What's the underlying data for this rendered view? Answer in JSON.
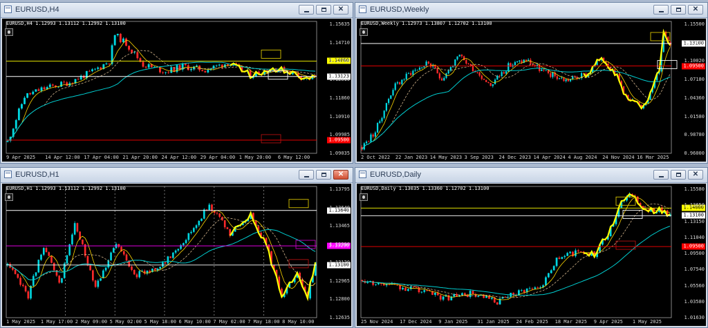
{
  "windows": [
    {
      "id": "h4",
      "title": "EURUSD,H4",
      "symbol_line": "EURUSD,H4  1.12993 1.13112 1.12992 1.13100",
      "prices": [
        "1.15635",
        "1.14710",
        "1.13760",
        "1.12810",
        "1.11860",
        "1.10910",
        "1.09985",
        "1.09035"
      ],
      "times": [
        "9 Apr 2025",
        "14 Apr 12:00",
        "17 Apr 04:00",
        "21 Apr 20:00",
        "24 Apr 12:00",
        "29 Apr 04:00",
        "1 May 20:00",
        "6 May 12:00"
      ],
      "tags": [
        {
          "text": "1.14000",
          "color": "#ffff00",
          "fg": "#000000"
        },
        {
          "text": "1.13123",
          "color": "#ffffff",
          "fg": "#000000"
        },
        {
          "text": "1.09500",
          "color": "#ff0000",
          "fg": "#ffffff"
        }
      ],
      "chart_data": {
        "type": "candlestick",
        "pmin": 1.0875,
        "pmax": 1.161,
        "n": 110,
        "seed": 11,
        "path": [
          [
            0,
            1.094
          ],
          [
            6,
            1.12
          ],
          [
            12,
            1.124
          ],
          [
            22,
            1.128
          ],
          [
            30,
            1.134
          ],
          [
            36,
            1.14
          ],
          [
            38,
            1.155
          ],
          [
            42,
            1.15
          ],
          [
            48,
            1.138
          ],
          [
            56,
            1.134
          ],
          [
            62,
            1.137
          ],
          [
            70,
            1.135
          ],
          [
            78,
            1.139
          ],
          [
            86,
            1.132
          ],
          [
            94,
            1.136
          ],
          [
            100,
            1.134
          ],
          [
            106,
            1.13
          ],
          [
            109,
            1.131
          ]
        ],
        "levels": [
          {
            "price": 1.14,
            "color": "#ffff00"
          },
          {
            "price": 1.13123,
            "color": "#ffffff"
          },
          {
            "price": 1.095,
            "color": "#ff0000"
          }
        ],
        "vgrid": [],
        "ma": [
          "#ffd700",
          "#d2b48c",
          "#00ced1"
        ]
      }
    },
    {
      "id": "weekly",
      "title": "EURUSD,Weekly",
      "symbol_line": "EURUSD,Weekly  1.12973 1.13807 1.12702 1.13100",
      "prices": [
        "1.15500",
        "1.12800",
        "1.10020",
        "1.07180",
        "1.04360",
        "1.01580",
        "0.98780",
        "0.96000"
      ],
      "times": [
        "2 Oct 2022",
        "22 Jan 2023",
        "14 May 2023",
        "3 Sep 2023",
        "24 Dec 2023",
        "14 Apr 2024",
        "4 Aug 2024",
        "24 Nov 2024",
        "16 Mar 2025"
      ],
      "tags": [
        {
          "text": "1.13100",
          "color": "#ffffff",
          "fg": "#000000"
        },
        {
          "text": "1.09500",
          "color": "#ff0000",
          "fg": "#ffffff"
        }
      ],
      "chart_data": {
        "type": "candlestick",
        "pmin": 0.955,
        "pmax": 1.162,
        "n": 140,
        "seed": 23,
        "path": [
          [
            0,
            0.965
          ],
          [
            6,
            0.99
          ],
          [
            14,
            1.06
          ],
          [
            22,
            1.085
          ],
          [
            30,
            1.1
          ],
          [
            36,
            1.075
          ],
          [
            44,
            1.11
          ],
          [
            52,
            1.085
          ],
          [
            58,
            1.065
          ],
          [
            66,
            1.095
          ],
          [
            74,
            1.105
          ],
          [
            82,
            1.085
          ],
          [
            92,
            1.072
          ],
          [
            102,
            1.082
          ],
          [
            108,
            1.11
          ],
          [
            114,
            1.085
          ],
          [
            120,
            1.04
          ],
          [
            126,
            1.03
          ],
          [
            130,
            1.05
          ],
          [
            134,
            1.09
          ],
          [
            136,
            1.15
          ],
          [
            139,
            1.131
          ]
        ],
        "levels": [
          {
            "price": 1.131,
            "color": "#ffffff"
          },
          {
            "price": 1.095,
            "color": "#ff0000"
          }
        ],
        "vgrid": [],
        "ma": [
          "#ffd700",
          "#d2b48c",
          "#00ced1"
        ]
      }
    },
    {
      "id": "h1",
      "title": "EURUSD,H1",
      "symbol_line": "EURUSD,H1  1.12993 1.13112 1.12992 1.13100",
      "prices": [
        "1.13795",
        "1.13640",
        "1.13465",
        "1.13290",
        "1.13120",
        "1.12965",
        "1.12800",
        "1.12635"
      ],
      "times": [
        "1 May 2025",
        "1 May 17:00",
        "2 May 09:00",
        "5 May 02:00",
        "5 May 18:00",
        "6 May 10:00",
        "7 May 02:00",
        "7 May 18:00",
        "8 May 10:00"
      ],
      "tags": [
        {
          "text": "1.13640",
          "color": "#ffffff",
          "fg": "#000000"
        },
        {
          "text": "1.13290",
          "color": "#ff00ff",
          "fg": "#ffffff"
        },
        {
          "text": "1.13100",
          "color": "#ffffff",
          "fg": "#000000"
        }
      ],
      "chart_data": {
        "type": "candlestick",
        "pmin": 1.1258,
        "pmax": 1.1385,
        "n": 120,
        "seed": 37,
        "path": [
          [
            0,
            1.131
          ],
          [
            8,
            1.128
          ],
          [
            14,
            1.133
          ],
          [
            20,
            1.129
          ],
          [
            26,
            1.135
          ],
          [
            34,
            1.129
          ],
          [
            42,
            1.133
          ],
          [
            50,
            1.13
          ],
          [
            60,
            1.131
          ],
          [
            70,
            1.134
          ],
          [
            78,
            1.137
          ],
          [
            86,
            1.134
          ],
          [
            94,
            1.136
          ],
          [
            100,
            1.133
          ],
          [
            106,
            1.128
          ],
          [
            112,
            1.13
          ],
          [
            116,
            1.128
          ],
          [
            119,
            1.131
          ]
        ],
        "levels": [
          {
            "price": 1.1364,
            "color": "#ffffff"
          },
          {
            "price": 1.1329,
            "color": "#ff00ff"
          },
          {
            "price": 1.131,
            "color": "#ffffff"
          }
        ],
        "vgrid": [
          0.19,
          0.35,
          0.51,
          0.67,
          0.83
        ],
        "ma": [
          "#ffd700",
          "#d2b48c",
          "#00ced1"
        ]
      }
    },
    {
      "id": "daily",
      "title": "EURUSD,Daily",
      "symbol_line": "EURUSD,Daily  1.13035 1.13360 1.12702 1.13100",
      "prices": [
        "1.15580",
        "1.13650",
        "1.13150",
        "1.11040",
        "1.09500",
        "1.07540",
        "1.05560",
        "1.03580",
        "1.01630"
      ],
      "times": [
        "25 Nov 2024",
        "17 Dec 2024",
        "9 Jan 2025",
        "31 Jan 2025",
        "24 Feb 2025",
        "18 Mar 2025",
        "9 Apr 2025",
        "1 May 2025"
      ],
      "tags": [
        {
          "text": "1.14000",
          "color": "#ffff00",
          "fg": "#000000"
        },
        {
          "text": "1.13100",
          "color": "#ffffff",
          "fg": "#000000"
        },
        {
          "text": "1.09500",
          "color": "#ff0000",
          "fg": "#ffffff"
        }
      ],
      "chart_data": {
        "type": "candlestick",
        "pmin": 1.012,
        "pmax": 1.162,
        "n": 115,
        "seed": 53,
        "path": [
          [
            0,
            1.056
          ],
          [
            10,
            1.05
          ],
          [
            20,
            1.045
          ],
          [
            30,
            1.035
          ],
          [
            40,
            1.04
          ],
          [
            50,
            1.03
          ],
          [
            60,
            1.045
          ],
          [
            66,
            1.048
          ],
          [
            72,
            1.08
          ],
          [
            80,
            1.09
          ],
          [
            86,
            1.085
          ],
          [
            92,
            1.115
          ],
          [
            96,
            1.15
          ],
          [
            100,
            1.155
          ],
          [
            106,
            1.135
          ],
          [
            110,
            1.14
          ],
          [
            114,
            1.131
          ]
        ],
        "levels": [
          {
            "price": 1.14,
            "color": "#ffff00"
          },
          {
            "price": 1.131,
            "color": "#ffffff"
          },
          {
            "price": 1.095,
            "color": "#ff0000"
          }
        ],
        "vgrid": [],
        "ma": [
          "#ffd700",
          "#d2b48c",
          "#00ced1"
        ]
      }
    }
  ]
}
